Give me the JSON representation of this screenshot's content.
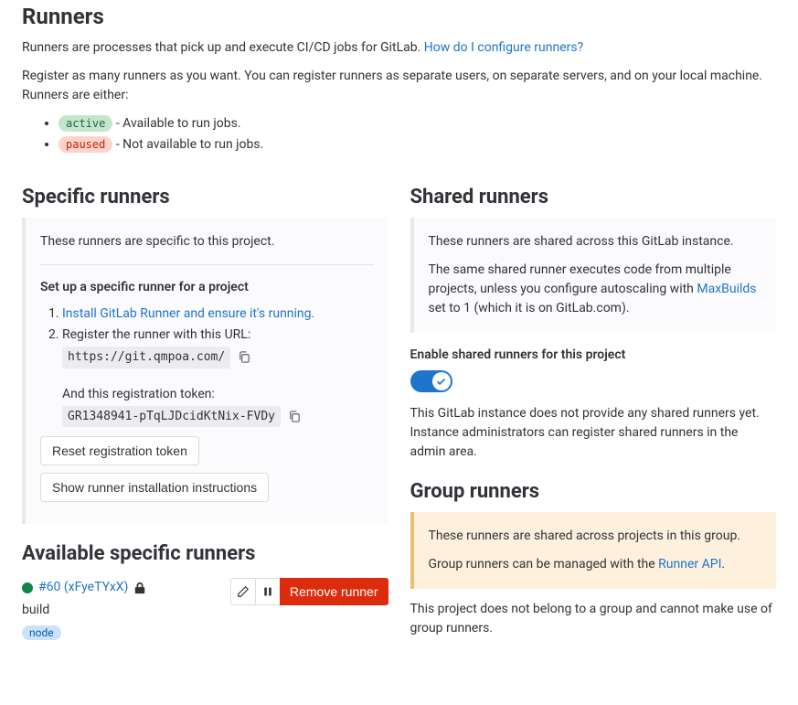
{
  "header": {
    "title": "Runners",
    "intro_prefix": "Runners are processes that pick up and execute CI/CD jobs for GitLab. ",
    "intro_link": "How do I configure runners?",
    "register_text": "Register as many runners as you want. You can register runners as separate users, on separate servers, and on your local machine. Runners are either:",
    "active_label": "active",
    "active_desc": " - Available to run jobs.",
    "paused_label": "paused",
    "paused_desc": " - Not available to run jobs."
  },
  "specific": {
    "title": "Specific runners",
    "intro": "These runners are specific to this project.",
    "setup_heading": "Set up a specific runner for a project",
    "step1_link": "Install GitLab Runner and ensure it's running.",
    "step2_text": "Register the runner with this URL:",
    "url": "https://git.qmpoa.com/",
    "token_text": "And this registration token:",
    "token": "GR1348941-pTqLJDcidKtNix-FVDy",
    "reset_btn": "Reset registration token",
    "show_btn": "Show runner installation instructions"
  },
  "available": {
    "title": "Available specific runners",
    "runner_link": "#60 (xFyeTYxX)",
    "runner_desc": "build",
    "runner_tag": "node",
    "remove_btn": "Remove runner"
  },
  "shared": {
    "title": "Shared runners",
    "intro": "These runners are shared across this GitLab instance.",
    "body_prefix": "The same shared runner executes code from multiple projects, unless you configure autoscaling with ",
    "body_link": "MaxBuilds",
    "body_suffix": " set to 1 (which it is on GitLab.com).",
    "toggle_label": "Enable shared runners for this project",
    "no_shared_text": "This GitLab instance does not provide any shared runners yet. Instance administrators can register shared runners in the admin area."
  },
  "group": {
    "title": "Group runners",
    "intro": "These runners are shared across projects in this group.",
    "body_prefix": "Group runners can be managed with the ",
    "body_link": "Runner API",
    "body_suffix": ".",
    "no_group_text": "This project does not belong to a group and cannot make use of group runners."
  }
}
